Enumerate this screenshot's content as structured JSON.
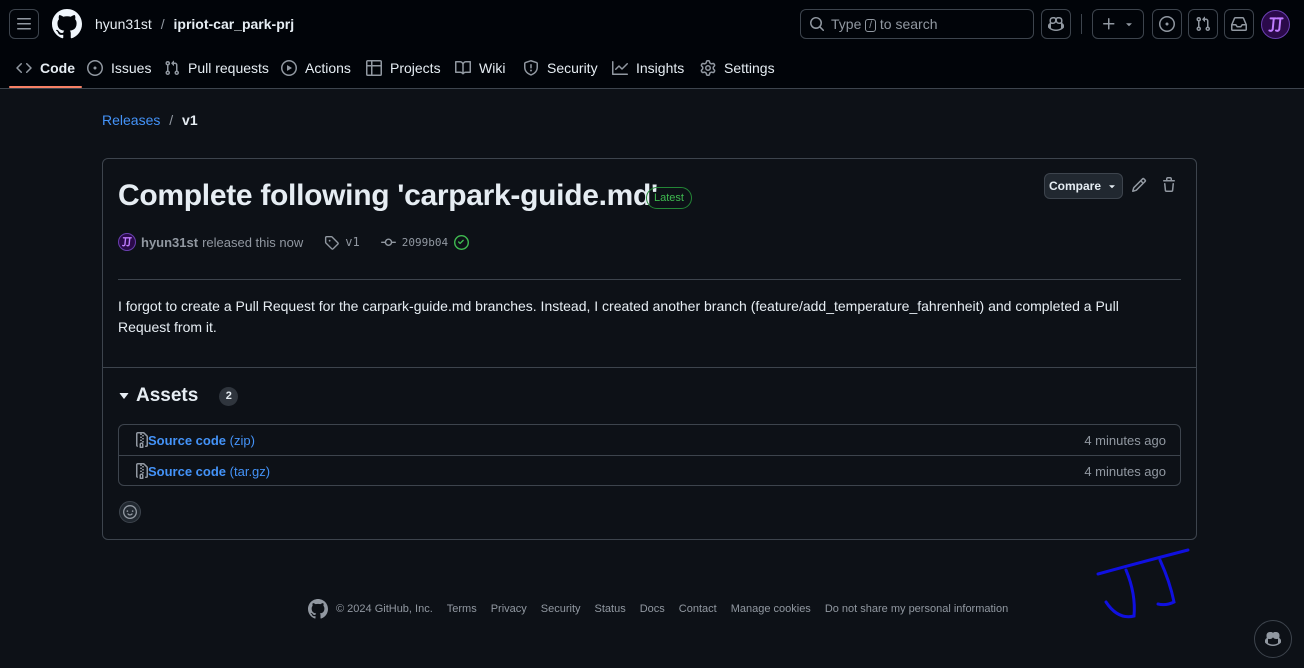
{
  "header": {
    "owner": "hyun31st",
    "separator": "/",
    "repo": "ipriot-car_park-prj",
    "search_placeholder": "Type / to search",
    "search_key": "/"
  },
  "tabs": [
    {
      "label": "Code",
      "icon": "code-icon",
      "active": true
    },
    {
      "label": "Issues",
      "icon": "issue-opened-icon"
    },
    {
      "label": "Pull requests",
      "icon": "git-pull-request-icon"
    },
    {
      "label": "Actions",
      "icon": "play-icon"
    },
    {
      "label": "Projects",
      "icon": "table-icon"
    },
    {
      "label": "Wiki",
      "icon": "book-icon"
    },
    {
      "label": "Security",
      "icon": "shield-icon"
    },
    {
      "label": "Insights",
      "icon": "graph-icon"
    },
    {
      "label": "Settings",
      "icon": "gear-icon"
    }
  ],
  "breadcrumb": {
    "parent": "Releases",
    "separator": "/",
    "current": "v1"
  },
  "release": {
    "title": "Complete following 'carpark-guide.md'",
    "badge": "Latest",
    "compare_label": "Compare",
    "author": "hyun31st",
    "released_text": "released this now",
    "tag": "v1",
    "commit": "2099b04",
    "body": "I forgot to create a Pull Request for the carpark-guide.md branches. Instead, I created another branch (feature/add_temperature_fahrenheit) and completed a Pull Request from it."
  },
  "assets": {
    "heading": "Assets",
    "count": "2",
    "items": [
      {
        "name": "Source code",
        "suffix": "(zip)",
        "time": "4 minutes ago"
      },
      {
        "name": "Source code",
        "suffix": "(tar.gz)",
        "time": "4 minutes ago"
      }
    ]
  },
  "footer": {
    "copyright": "© 2024 GitHub, Inc.",
    "links": [
      "Terms",
      "Privacy",
      "Security",
      "Status",
      "Docs",
      "Contact",
      "Manage cookies",
      "Do not share my personal information"
    ]
  },
  "colors": {
    "background": "#0d1117",
    "header": "#010409",
    "accent_link": "#4493f8",
    "latest_green": "#3fb950",
    "tab_underline": "#f78166",
    "signature": "#1010e0"
  }
}
